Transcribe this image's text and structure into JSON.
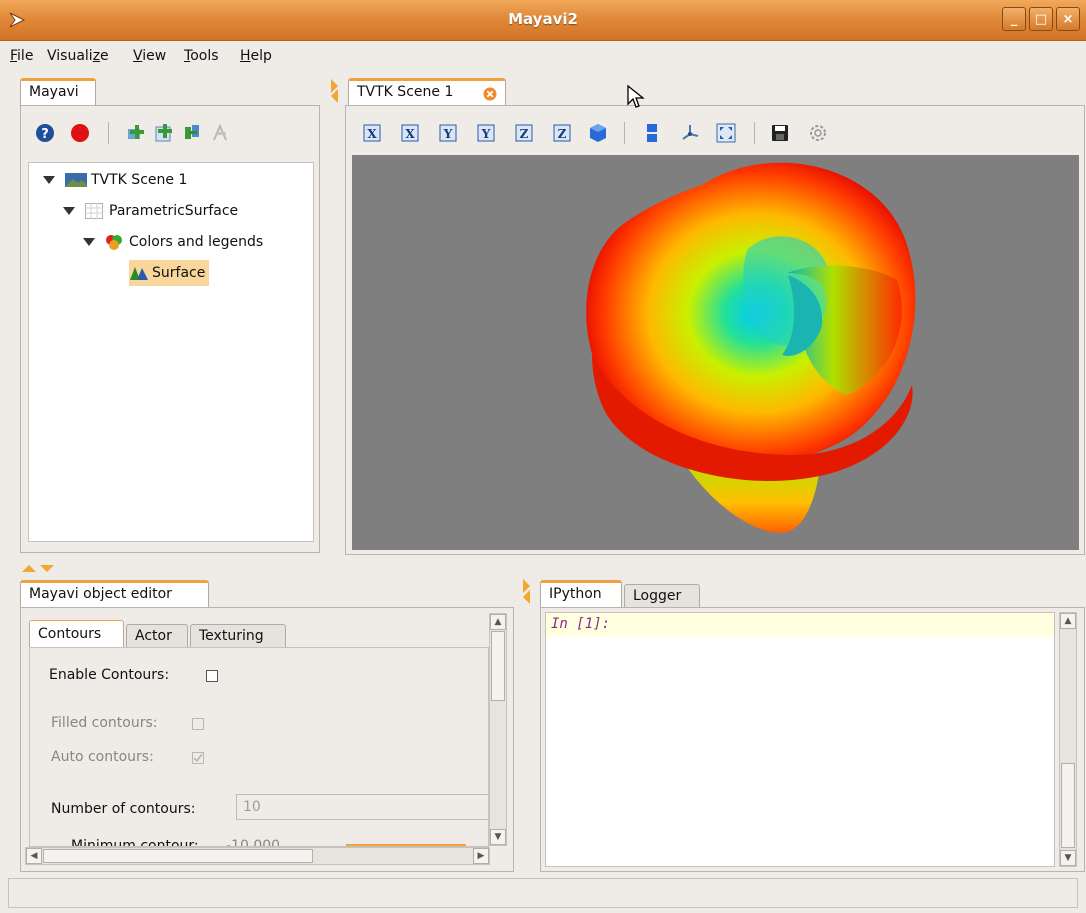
{
  "window": {
    "title": "Mayavi2"
  },
  "menu": [
    "File",
    "Visualize",
    "View",
    "Tools",
    "Help"
  ],
  "menu_mnemonics": [
    "F",
    "z",
    "V",
    "T",
    "H"
  ],
  "left_panel": {
    "tab": "Mayavi"
  },
  "tree": {
    "scene": "TVTK Scene 1",
    "source": "ParametricSurface",
    "module_manager": "Colors and legends",
    "module": "Surface"
  },
  "scene_tab": {
    "label": "TVTK Scene 1"
  },
  "scene_toolbar_icons": [
    "view-x-pos-icon",
    "view-x-neg-icon",
    "view-y-pos-icon",
    "view-y-neg-icon",
    "view-z-pos-icon",
    "view-z-neg-icon",
    "isometric-view-icon",
    "parallel-projection-icon",
    "axes-icon",
    "fullscreen-icon",
    "save-icon",
    "settings-icon"
  ],
  "toolbar_labels": {
    "x": "X",
    "y": "Y",
    "z": "Z"
  },
  "editor": {
    "tab": "Mayavi object editor",
    "subtabs": [
      "Contours",
      "Actor",
      "Texturing"
    ],
    "enable_contours_label": "Enable Contours:",
    "filled_contours_label": "Filled contours:",
    "auto_contours_label": "Auto contours:",
    "number_of_contours_label": "Number of contours:",
    "number_of_contours_value": "10",
    "minimum_contour_label": "Minimum contour:",
    "minimum_contour_value": "-10.000",
    "enable_contours": false,
    "filled_contours": false,
    "auto_contours": true
  },
  "console": {
    "tabs": [
      "IPython",
      "Logger"
    ],
    "prompt": "In [1]:"
  },
  "colors": {
    "accent": "#f0a040",
    "titlebar": "#e08a3a",
    "scene_bg": "#7f7f7f",
    "tree_selection": "#f9d69c",
    "prompt_bg": "#ffffe0",
    "prompt_text": "#8a2a8a"
  }
}
